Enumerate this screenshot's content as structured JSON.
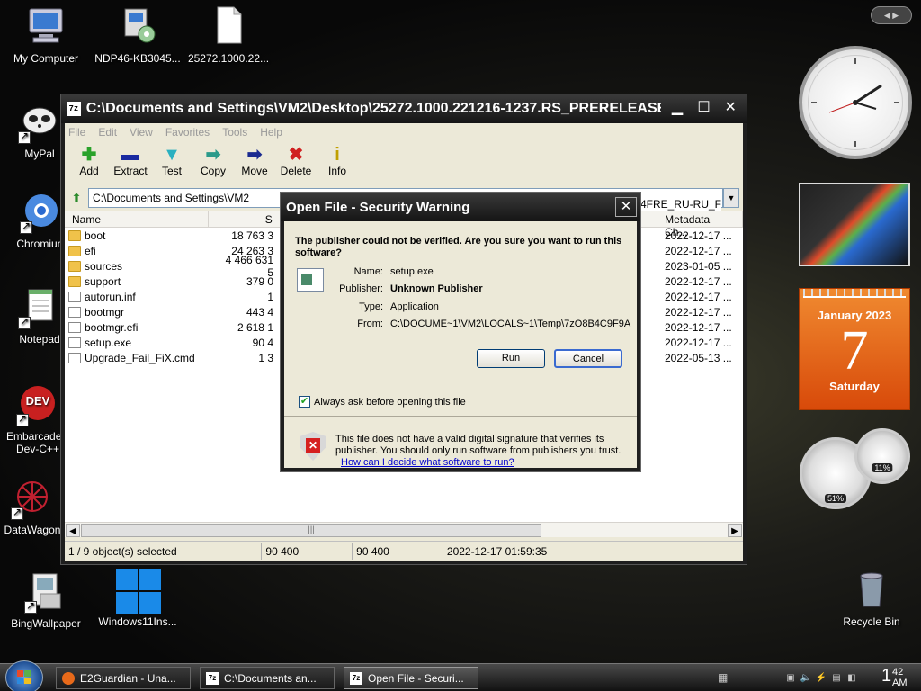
{
  "desktop": {
    "icons": [
      {
        "label": "My Computer",
        "icon": "computer-icon"
      },
      {
        "label": "NDP46-KB3045...",
        "icon": "installer-icon"
      },
      {
        "label": "25272.1000.22...",
        "icon": "file-icon"
      },
      {
        "label": "MyPal",
        "icon": "mypal-icon"
      },
      {
        "label": "Chromium",
        "icon": "chromium-icon"
      },
      {
        "label": "Notepad",
        "icon": "notepad-icon"
      },
      {
        "label": "Embarcadero Dev-C++",
        "icon": "devcpp-icon"
      },
      {
        "label": "DataWagon",
        "icon": "datawagon-icon"
      },
      {
        "label": "BingWallpaper",
        "icon": "bingwallpaper-icon"
      },
      {
        "label": "Windows11Ins...",
        "icon": "windows11-icon"
      },
      {
        "label": "Recycle Bin",
        "icon": "recycle-bin-icon"
      }
    ]
  },
  "file_manager": {
    "title": "C:\\Documents and Settings\\VM2\\Desktop\\25272.1000.221216-1237.RS_PRERELEASE...",
    "title_icon": "7z",
    "menu": [
      "File",
      "Edit",
      "View",
      "Favorites",
      "Tools",
      "Help"
    ],
    "toolbar": [
      {
        "label": "Add",
        "glyph": "✚",
        "color": "#2aa22a"
      },
      {
        "label": "Extract",
        "glyph": "▬",
        "color": "#1a2aa0"
      },
      {
        "label": "Test",
        "glyph": "▼",
        "color": "#2ab0c0"
      },
      {
        "label": "Copy",
        "glyph": "➡",
        "color": "#2a9a8a"
      },
      {
        "label": "Move",
        "glyph": "➡",
        "color": "#1a2a90"
      },
      {
        "label": "Delete",
        "glyph": "✖",
        "color": "#d02020"
      },
      {
        "label": "Info",
        "glyph": "i",
        "color": "#c0a000"
      }
    ],
    "address": "C:\\Documents and Settings\\VM2",
    "address_tail": "64FRE_RU-RU_F",
    "columns": {
      "name": "Name",
      "size": "S",
      "metadata": "Metadata Ch..."
    },
    "files": [
      {
        "name": "boot",
        "size": "18 763 3",
        "modified": "2022-12-17 ...",
        "kind": "folder"
      },
      {
        "name": "efi",
        "size": "24 263 3",
        "modified": "2022-12-17 ...",
        "kind": "folder"
      },
      {
        "name": "sources",
        "size": "4 466 631 5",
        "modified": "2023-01-05 ...",
        "kind": "folder"
      },
      {
        "name": "support",
        "size": "379 0",
        "modified": "2022-12-17 ...",
        "kind": "folder"
      },
      {
        "name": "autorun.inf",
        "size": "1",
        "modified": "2022-12-17 ...",
        "kind": "file"
      },
      {
        "name": "bootmgr",
        "size": "443 4",
        "modified": "2022-12-17 ...",
        "kind": "file"
      },
      {
        "name": "bootmgr.efi",
        "size": "2 618 1",
        "modified": "2022-12-17 ...",
        "kind": "file"
      },
      {
        "name": "setup.exe",
        "size": "90 4",
        "modified": "2022-12-17 ...",
        "kind": "file"
      },
      {
        "name": "Upgrade_Fail_FiX.cmd",
        "size": "1 3",
        "modified": "2022-05-13 ...",
        "kind": "file"
      }
    ],
    "status": {
      "selected": "1 / 9 object(s) selected",
      "size": "90 400",
      "packed": "90 400",
      "date": "2022-12-17 01:59:35"
    }
  },
  "dialog": {
    "title": "Open File - Security Warning",
    "question": "The publisher could not be verified.  Are you sure you want to run this software?",
    "fields": [
      {
        "key": "Name:",
        "value": "setup.exe",
        "bold": false
      },
      {
        "key": "Publisher:",
        "value": "Unknown Publisher",
        "bold": true
      },
      {
        "key": "Type:",
        "value": "Application",
        "bold": false
      },
      {
        "key": "From:",
        "value": "C:\\DOCUME~1\\VM2\\LOCALS~1\\Temp\\7zO8B4C9F9A",
        "bold": false
      }
    ],
    "run_label": "Run",
    "cancel_label": "Cancel",
    "checkbox_label": "Always ask before opening this file",
    "checkbox_checked": true,
    "warning_text": "This file does not have a valid digital signature that verifies its publisher.  You should only run software from publishers you trust.",
    "help_link": "How can I decide what software to run?"
  },
  "gadgets": {
    "calendar": {
      "month": "January 2023",
      "day": "7",
      "weekday": "Saturday"
    },
    "cpu_percent": "51%",
    "memory_percent": "11%"
  },
  "taskbar": {
    "tasks": [
      {
        "label": "E2Guardian - Una...",
        "icon": "firefox-icon",
        "active": false
      },
      {
        "label": "C:\\Documents an...",
        "icon": "7zip-icon",
        "active": false
      },
      {
        "label": "Open File - Securi...",
        "icon": "7zip-icon",
        "active": true
      }
    ],
    "clock_minute": "42",
    "clock_hour": "1",
    "clock_ampm": "AM"
  }
}
